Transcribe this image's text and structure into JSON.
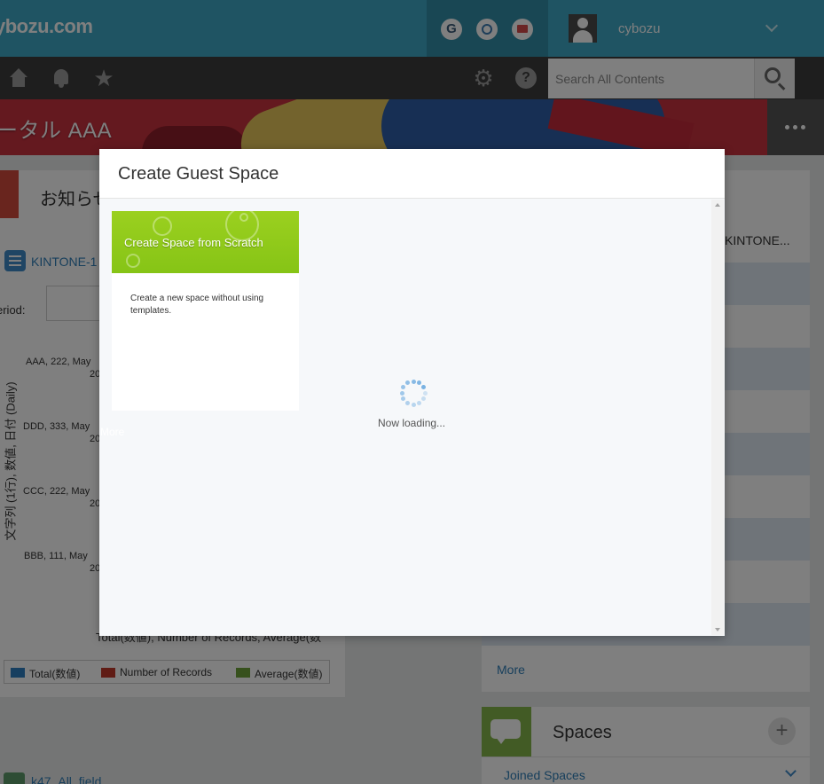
{
  "header": {
    "logo": "ybozu.com",
    "services": [
      "G",
      "O",
      "M"
    ],
    "username": "cybozu"
  },
  "nav": {
    "icons": [
      "home-icon",
      "bell-icon",
      "star-icon",
      "gear-icon",
      "help-icon"
    ],
    "search_placeholder": "Search All Contents"
  },
  "banner": {
    "title": "ータル AAA"
  },
  "notices": {
    "title": "お知らせ"
  },
  "report": {
    "app_link": "KINTONE-1",
    "period_label": "eriod:",
    "axis_title": "文字列 (1行), 数値, 日付 (Daily)",
    "categories": [
      {
        "label": "AAA, 222, May",
        "year": "20"
      },
      {
        "label": "DDD, 333, May",
        "year": "20"
      },
      {
        "label": "CCC, 222, May",
        "year": "20"
      },
      {
        "label": "BBB, 111, May",
        "year": "20"
      }
    ],
    "more": "More",
    "footer_text": "Total(数値), Number of Records, Average(数",
    "legend": [
      {
        "label": "Total(数値)",
        "color": "#2f7fc1"
      },
      {
        "label": "Number of Records",
        "color": "#c0392b"
      },
      {
        "label": "Average(数値)",
        "color": "#6fa33a"
      }
    ]
  },
  "bottom_left": {
    "link": "k47_All_field"
  },
  "right": {
    "item": "KINTONE...",
    "more": "More"
  },
  "spaces": {
    "title": "Spaces",
    "add_symbol": "+",
    "joined_label": "Joined Spaces"
  },
  "modal": {
    "title": "Create Guest Space",
    "card": {
      "title": "Create Space from Scratch",
      "description": "Create a new space without using templates."
    },
    "loading_text": "Now loading..."
  },
  "colors": {
    "header": "#3ea9c6",
    "navbar": "#3d3d3d",
    "card_green": "#8fc91a",
    "link": "#2f7fb9"
  }
}
